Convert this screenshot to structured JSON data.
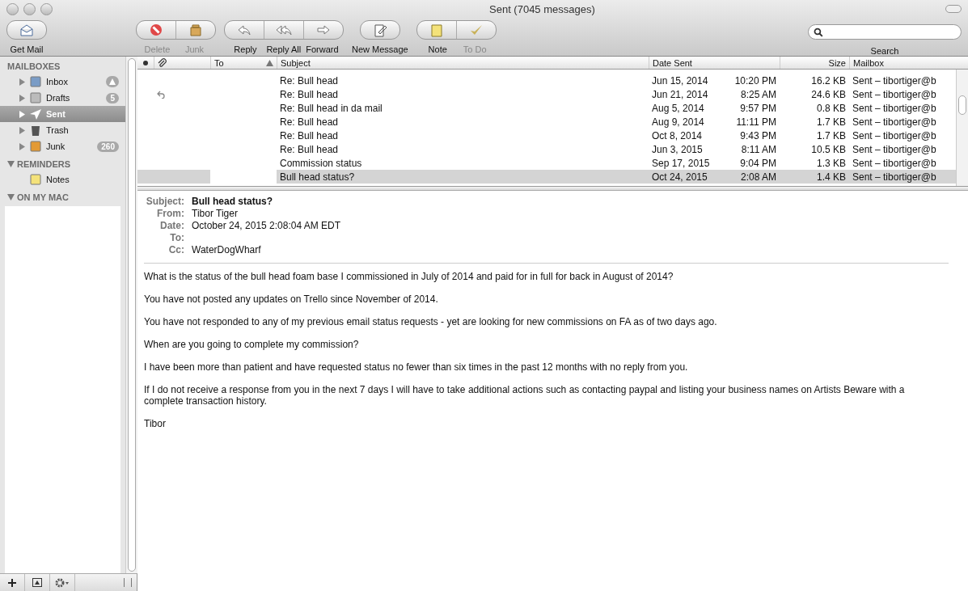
{
  "window": {
    "title": "Sent (7045 messages)"
  },
  "toolbar": {
    "groups": [
      [
        {
          "label": "Get Mail",
          "disabled": false
        }
      ],
      [
        {
          "label": "Delete",
          "disabled": true
        },
        {
          "label": "Junk",
          "disabled": true
        }
      ],
      [
        {
          "label": "Reply",
          "disabled": false
        },
        {
          "label": "Reply All",
          "disabled": false
        },
        {
          "label": "Forward",
          "disabled": false
        }
      ],
      [
        {
          "label": "New Message",
          "disabled": false
        }
      ],
      [
        {
          "label": "Note",
          "disabled": false
        },
        {
          "label": "To Do",
          "disabled": true
        }
      ]
    ],
    "search": {
      "label": "Search"
    }
  },
  "sidebar": {
    "sections": [
      {
        "title": "MAILBOXES",
        "items": [
          {
            "label": "Inbox",
            "alert": true,
            "selected": false
          },
          {
            "label": "Drafts",
            "badge": "5",
            "alert": false,
            "selected": false
          },
          {
            "label": "Sent",
            "alert": false,
            "selected": true
          },
          {
            "label": "Trash",
            "alert": false,
            "selected": false
          },
          {
            "label": "Junk",
            "badge": "260",
            "alert": false,
            "selected": false
          }
        ]
      },
      {
        "title": "REMINDERS",
        "expanded": true,
        "items": [
          {
            "label": "Notes",
            "alert": false,
            "selected": false
          }
        ]
      },
      {
        "title": "ON MY MAC",
        "expanded": true
      }
    ]
  },
  "table": {
    "columns": [
      {
        "label": "To",
        "sorted": true
      },
      {
        "label": "Subject",
        "sorted": false
      },
      {
        "label": "Date Sent",
        "sorted": false
      },
      {
        "label": "Size",
        "sorted": false
      },
      {
        "label": "Mailbox",
        "sorted": false
      }
    ],
    "rows": [
      {
        "replied": false,
        "subject": "Re: Bull head",
        "date": "Jun 15, 2014",
        "time": "10:20 PM",
        "size": "16.2 KB",
        "mailbox": "Sent – tibortiger@b",
        "selected": false
      },
      {
        "replied": true,
        "subject": "Re: Bull head",
        "date": "Jun 21, 2014",
        "time": "8:25 AM",
        "size": "24.6 KB",
        "mailbox": "Sent – tibortiger@b",
        "selected": false
      },
      {
        "replied": false,
        "subject": "Re: Bull head in da mail",
        "date": "Aug 5, 2014",
        "time": "9:57 PM",
        "size": "0.8 KB",
        "mailbox": "Sent – tibortiger@b",
        "selected": false
      },
      {
        "replied": false,
        "subject": "Re: Bull head",
        "date": "Aug 9, 2014",
        "time": "11:11 PM",
        "size": "1.7 KB",
        "mailbox": "Sent – tibortiger@b",
        "selected": false
      },
      {
        "replied": false,
        "subject": "Re: Bull head",
        "date": "Oct 8, 2014",
        "time": "9:43 PM",
        "size": "1.7 KB",
        "mailbox": "Sent – tibortiger@b",
        "selected": false
      },
      {
        "replied": false,
        "subject": "Re: Bull head",
        "date": "Jun 3, 2015",
        "time": "8:11 AM",
        "size": "10.5 KB",
        "mailbox": "Sent – tibortiger@b",
        "selected": false
      },
      {
        "replied": false,
        "subject": "Commission status",
        "date": "Sep 17, 2015",
        "time": "9:04 PM",
        "size": "1.3 KB",
        "mailbox": "Sent – tibortiger@b",
        "selected": false
      },
      {
        "replied": false,
        "subject": "Bull head status?",
        "date": "Oct 24, 2015",
        "time": "2:08 AM",
        "size": "1.4 KB",
        "mailbox": "Sent – tibortiger@b",
        "selected": true
      }
    ]
  },
  "message": {
    "headers": [
      {
        "label": "Subject:",
        "value": "Bull head status?",
        "kind": "subject"
      },
      {
        "label": "From:",
        "value": "Tibor Tiger",
        "kind": "plain"
      },
      {
        "label": "Date:",
        "value": "October 24, 2015 2:08:04 AM EDT",
        "kind": "plain"
      },
      {
        "label": "To:",
        "kind": "plain"
      },
      {
        "label": "Cc:",
        "value": "WaterDogWharf",
        "kind": "plain"
      }
    ],
    "body": [
      "What is the status of the bull head foam base I commissioned in July of 2014 and paid for in full for back in August of 2014?",
      "You have not posted any updates on Trello since November of 2014.",
      "You have not responded to any of my previous email status requests - yet are looking for new commissions on FA as of two days ago.",
      "When are you going to complete my commission?",
      "I have been more than patient and have requested status no fewer than six times in the past 12 months with no reply from you.",
      "If I do not receive a response from you in the next 7 days I will have to take additional actions such as contacting paypal and listing your business names on Artists Beware with a complete transaction history.",
      "Tibor"
    ]
  }
}
